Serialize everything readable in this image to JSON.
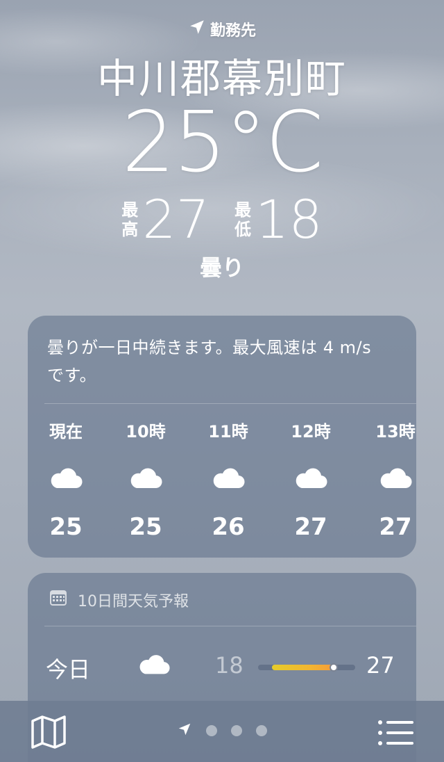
{
  "header": {
    "location_label": "勤務先",
    "city": "中川郡幕別町",
    "temperature": "25°C",
    "high_label_1": "最",
    "high_label_2": "高",
    "high": "27",
    "low_label_1": "最",
    "low_label_2": "低",
    "low": "18",
    "condition": "曇り"
  },
  "hourly": {
    "summary": "曇りが一日中続きます。最大風速は 4 m/s です。",
    "items": [
      {
        "time": "現在",
        "icon": "cloud-icon",
        "temp": "25"
      },
      {
        "time": "10時",
        "icon": "cloud-icon",
        "temp": "25"
      },
      {
        "time": "11時",
        "icon": "cloud-icon",
        "temp": "26"
      },
      {
        "time": "12時",
        "icon": "cloud-icon",
        "temp": "27"
      },
      {
        "time": "13時",
        "icon": "cloud-icon",
        "temp": "27"
      }
    ]
  },
  "daily": {
    "title": "10日間天気予報",
    "title_icon": "calendar-icon",
    "days": [
      {
        "day": "今日",
        "icon": "cloud-icon",
        "low": "18",
        "high": "27",
        "current_temp_fraction": 0.78
      }
    ]
  },
  "toolbar": {
    "map_icon": "map-icon",
    "location_icon": "location-arrow-icon",
    "page_count": 3,
    "list_icon": "list-icon"
  },
  "colors": {
    "card": "#64748c",
    "bar_yellow": "#e6cc2a",
    "bar_orange": "#f59a3a"
  }
}
